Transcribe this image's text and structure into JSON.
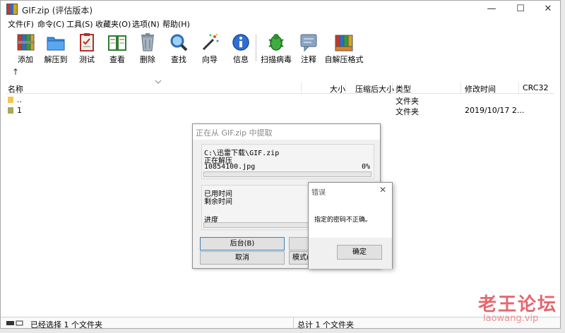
{
  "window": {
    "title": "GIF.zip (评估版本)",
    "controls": {
      "minimize": "—",
      "maximize": "☐",
      "close": "✕"
    }
  },
  "menu": [
    {
      "label": "文件(F)"
    },
    {
      "label": "命令(C)"
    },
    {
      "label": "工具(S)"
    },
    {
      "label": "收藏夹(O)"
    },
    {
      "label": "选项(N)"
    },
    {
      "label": "帮助(H)"
    }
  ],
  "toolbar": [
    {
      "label": "添加",
      "icon": "books-add-icon"
    },
    {
      "label": "解压到",
      "icon": "folder-extract-icon"
    },
    {
      "label": "测试",
      "icon": "clipboard-check-icon"
    },
    {
      "label": "查看",
      "icon": "book-view-icon"
    },
    {
      "label": "删除",
      "icon": "trash-icon"
    },
    {
      "label": "查找",
      "icon": "magnifier-icon"
    },
    {
      "label": "向导",
      "icon": "wand-icon"
    },
    {
      "label": "信息",
      "icon": "info-icon"
    },
    {
      "label": "扫描病毒",
      "icon": "bug-scan-icon"
    },
    {
      "label": "注释",
      "icon": "comment-icon"
    },
    {
      "label": "自解压格式",
      "icon": "sfx-icon"
    }
  ],
  "nav": {
    "up_arrow": "↑"
  },
  "list": {
    "columns": [
      "名称",
      "大小",
      "压缩后大小",
      "类型",
      "修改时间",
      "CRC32"
    ],
    "rows": [
      {
        "name": "..",
        "size": "",
        "packed": "",
        "type": "文件夹",
        "modified": "",
        "crc": ""
      },
      {
        "name": "1",
        "size": "",
        "packed": "",
        "type": "文件夹",
        "modified": "2019/10/17 2...",
        "crc": ""
      }
    ]
  },
  "status": {
    "left": "已经选择 1 个文件夹",
    "right": "总计 1 个文件夹"
  },
  "extract_dialog": {
    "title": "正在从 GIF.zip 中提取",
    "archive_path": "C:\\迅雷下载\\GIF.zip",
    "action": "正在解压",
    "current_file": "10854100.jpg",
    "file_percent": "0%",
    "elapsed_label": "已用时间",
    "remaining_label": "剩余时间",
    "progress_label": "进度",
    "background_button": "后台(B)",
    "cancel_button": "取消",
    "mode_button": "模式(",
    "file_progress": 0.0
  },
  "error_dialog": {
    "title": "错误",
    "close": "✕",
    "message": "指定的密码不正确。",
    "ok_button": "确定"
  },
  "watermark": {
    "line1": "老王论坛",
    "line2": "laowang.vip"
  },
  "colors": {
    "accent_red": "#dc3c46",
    "selected_row": "#cce4f7"
  }
}
